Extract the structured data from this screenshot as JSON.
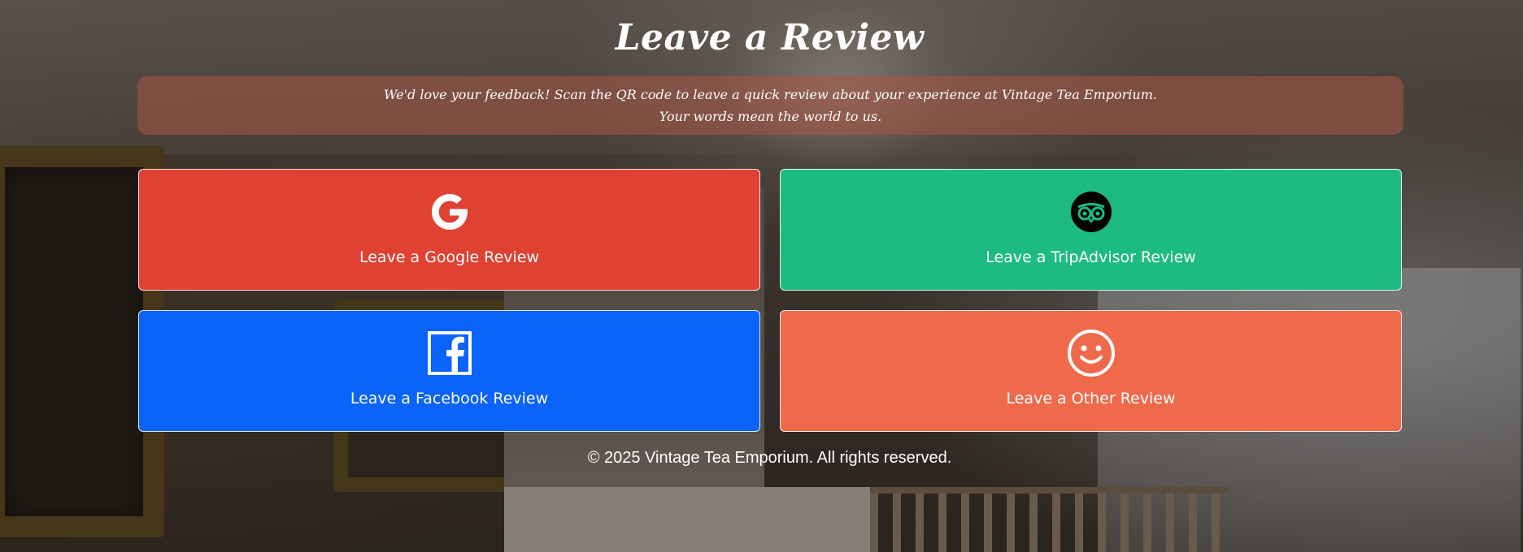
{
  "page": {
    "title": "Leave a Review",
    "intro_line1": "We'd love your feedback! Scan the QR code to leave a quick review about your experience at Vintage Tea Emporium.",
    "intro_line2": "Your words mean the world to us."
  },
  "review_buttons": [
    {
      "label": "Leave a Google Review",
      "icon": "google-icon",
      "color": "#e04132"
    },
    {
      "label": "Leave a TripAdvisor Review",
      "icon": "tripadvisor-icon",
      "color": "#1dbb82"
    },
    {
      "label": "Leave a Facebook Review",
      "icon": "facebook-icon",
      "color": "#0a63fa"
    },
    {
      "label": "Leave a Other Review",
      "icon": "smiley-icon",
      "color": "#ee6a4b"
    }
  ],
  "footer": {
    "copyright": "© 2025 Vintage Tea Emporium. All rights reserved."
  }
}
